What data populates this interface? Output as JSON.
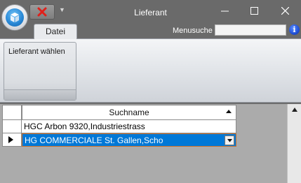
{
  "window": {
    "title": "Lieferant"
  },
  "menu": {
    "tab_label": "Datei",
    "search_label": "Menusuche",
    "search_value": "",
    "info_label": "i"
  },
  "ribbon": {
    "button_label": "Lieferant wählen"
  },
  "grid": {
    "column_header": "Suchname",
    "rows": [
      {
        "value": "HGC Arbon 9320,Industriestrass",
        "selected": false
      },
      {
        "value": "HG COMMERCIALE St. Gallen,Scho",
        "selected": true
      }
    ]
  },
  "colors": {
    "selection": "#0078d7",
    "titlebar": "#6a6a6a",
    "ribbon_light": "#f4f5f7"
  },
  "icons": {
    "app_menu": "3d-cube-icon",
    "quick_access": "red-x-icon",
    "info": "info-icon"
  }
}
